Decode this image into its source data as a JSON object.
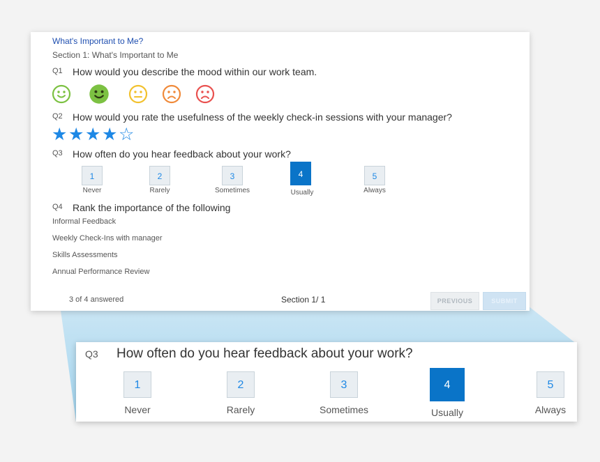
{
  "survey": {
    "title": "What's Important to Me?",
    "section_title": "Section 1: What's Important to Me"
  },
  "questions": {
    "q1": {
      "num": "Q1",
      "text": "How would you describe the mood within our work team."
    },
    "q2": {
      "num": "Q2",
      "text": "How would you rate the usefulness of the weekly check-in sessions with your manager?"
    },
    "q3": {
      "num": "Q3",
      "text": "How often do you hear feedback about your work?"
    },
    "q4": {
      "num": "Q4",
      "text": "Rank the importance of the following"
    }
  },
  "mood_faces": [
    {
      "name": "very-happy",
      "color": "#7cc142",
      "selected": false
    },
    {
      "name": "happy",
      "color": "#7cc142",
      "selected": true
    },
    {
      "name": "neutral",
      "color": "#f2c12e",
      "selected": false
    },
    {
      "name": "sad",
      "color": "#f08a3a",
      "selected": false
    },
    {
      "name": "very-sad",
      "color": "#e9514f",
      "selected": false
    }
  ],
  "rating": {
    "value": 4,
    "max": 5,
    "color": "#1e88e5"
  },
  "scale": {
    "options": [
      {
        "num": "1",
        "label": "Never"
      },
      {
        "num": "2",
        "label": "Rarely"
      },
      {
        "num": "3",
        "label": "Sometimes"
      },
      {
        "num": "4",
        "label": "Usually"
      },
      {
        "num": "5",
        "label": "Always"
      }
    ],
    "selected": "4"
  },
  "rank_items": [
    "Informal Feedback",
    "Weekly Check-Ins with manager",
    "Skills Assessments",
    "Annual Performance Review"
  ],
  "footer": {
    "answered": "3 of 4 answered",
    "section": "Section 1/ 1",
    "previous_label": "PREVIOUS",
    "submit_label": "SUBMIT"
  },
  "colors": {
    "accent": "#0a74c8",
    "link": "#1f4fb0",
    "wedge": "#a9d8f0"
  }
}
